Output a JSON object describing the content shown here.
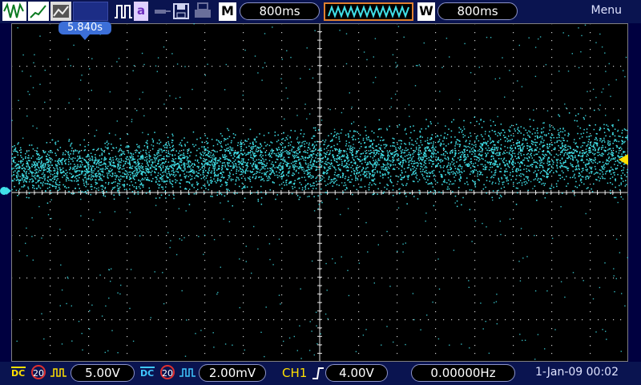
{
  "toolbar": {
    "icons": [
      "waveform-icon",
      "xy-plot-icon",
      "image-icon",
      "blank-slot",
      "pulse-icon",
      "text-icon",
      "probe-icon",
      "save-icon",
      "print-icon"
    ],
    "text_icon_label": "a",
    "timebase_mode": "M",
    "timebase_value": "800ms",
    "window_mode": "W",
    "window_value": "800ms",
    "menu_label": "Menu"
  },
  "screen": {
    "trigger_time": "5.840s",
    "trace_color": "#40e0e8",
    "grid_color": "#c8c8c8",
    "trigger_marker_color": "#ffe000",
    "ground_marker_color": "#40e0e8"
  },
  "bottombar": {
    "ch1": {
      "coupling": "DC",
      "bandwidth": "20",
      "scale": "5.00V",
      "color": "#ffe000"
    },
    "ch2": {
      "coupling": "DC",
      "bandwidth": "20",
      "scale": "2.00mV",
      "color": "#40c8ff"
    },
    "trigger": {
      "source": "CH1",
      "level": "4.00V"
    },
    "frequency": "0.00000Hz",
    "datetime": "1-Jan-09 00:02"
  }
}
